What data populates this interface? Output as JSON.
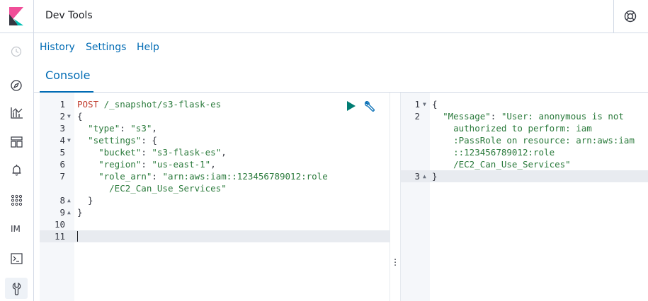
{
  "header": {
    "app_title": "Dev Tools",
    "logo_icon": "kibana-logo-icon",
    "help_icon": "help-lifebuoy-icon"
  },
  "sidenav": {
    "items": [
      {
        "name": "recently-viewed-icon",
        "active": false
      },
      {
        "name": "discover-compass-icon",
        "active": false
      },
      {
        "name": "visualize-chart-icon",
        "active": false
      },
      {
        "name": "dashboard-icon",
        "active": false
      },
      {
        "name": "alerting-bell-icon",
        "active": false
      },
      {
        "name": "apps-grid-icon",
        "active": false
      },
      {
        "name": "index-management-label",
        "label": "IM",
        "active": false
      },
      {
        "name": "console-terminal-icon",
        "active": false
      },
      {
        "name": "management-wrench-icon",
        "active": true
      }
    ]
  },
  "menu": {
    "history": "History",
    "settings": "Settings",
    "help": "Help"
  },
  "tabs": {
    "console": "Console"
  },
  "request_editor": {
    "lines": [
      {
        "num": "1",
        "fold": "",
        "text": [
          [
            "kw",
            "POST "
          ],
          [
            "path",
            "/_snapshot/s3-flask-es"
          ]
        ]
      },
      {
        "num": "2",
        "fold": "down",
        "text": [
          [
            "punc",
            "{"
          ]
        ]
      },
      {
        "num": "3",
        "fold": "",
        "text": [
          [
            "punc",
            "  "
          ],
          [
            "key",
            "\"type\""
          ],
          [
            "punc",
            ": "
          ],
          [
            "str",
            "\"s3\""
          ],
          [
            "punc",
            ","
          ]
        ]
      },
      {
        "num": "4",
        "fold": "down",
        "text": [
          [
            "punc",
            "  "
          ],
          [
            "key",
            "\"settings\""
          ],
          [
            "punc",
            ": {"
          ]
        ]
      },
      {
        "num": "5",
        "fold": "",
        "text": [
          [
            "punc",
            "    "
          ],
          [
            "key",
            "\"bucket\""
          ],
          [
            "punc",
            ": "
          ],
          [
            "str",
            "\"s3-flask-es\""
          ],
          [
            "punc",
            ","
          ]
        ]
      },
      {
        "num": "6",
        "fold": "",
        "text": [
          [
            "punc",
            "    "
          ],
          [
            "key",
            "\"region\""
          ],
          [
            "punc",
            ": "
          ],
          [
            "str",
            "\"us-east-1\""
          ],
          [
            "punc",
            ","
          ]
        ]
      },
      {
        "num": "7",
        "fold": "",
        "text": [
          [
            "punc",
            "    "
          ],
          [
            "key",
            "\"role_arn\""
          ],
          [
            "punc",
            ": "
          ],
          [
            "str",
            "\"arn:aws:iam::123456789012:role"
          ]
        ]
      },
      {
        "num": "",
        "fold": "",
        "text": [
          [
            "punc",
            "      "
          ],
          [
            "str",
            "/EC2_Can_Use_Services\""
          ]
        ]
      },
      {
        "num": "8",
        "fold": "up",
        "text": [
          [
            "punc",
            "  }"
          ]
        ]
      },
      {
        "num": "9",
        "fold": "up",
        "text": [
          [
            "punc",
            "}"
          ]
        ]
      },
      {
        "num": "10",
        "fold": "",
        "text": []
      },
      {
        "num": "11",
        "fold": "",
        "text": [],
        "active": true
      }
    ],
    "play_icon": "play-request-icon",
    "wrench_icon": "request-options-wrench-icon"
  },
  "response_editor": {
    "lines": [
      {
        "num": "1",
        "fold": "down",
        "text": [
          [
            "punc",
            "{"
          ]
        ]
      },
      {
        "num": "2",
        "fold": "",
        "text": [
          [
            "punc",
            "  "
          ],
          [
            "key",
            "\"Message\""
          ],
          [
            "punc",
            ": "
          ],
          [
            "str",
            "\"User: anonymous is not"
          ]
        ]
      },
      {
        "num": "",
        "fold": "",
        "text": [
          [
            "punc",
            "    "
          ],
          [
            "str",
            "authorized to perform: iam"
          ]
        ]
      },
      {
        "num": "",
        "fold": "",
        "text": [
          [
            "punc",
            "    "
          ],
          [
            "str",
            ":PassRole on resource: arn:aws:iam"
          ]
        ]
      },
      {
        "num": "",
        "fold": "",
        "text": [
          [
            "punc",
            "    "
          ],
          [
            "str",
            "::123456789012:role"
          ]
        ]
      },
      {
        "num": "",
        "fold": "",
        "text": [
          [
            "punc",
            "    "
          ],
          [
            "str",
            "/EC2_Can_Use_Services\""
          ]
        ]
      },
      {
        "num": "3",
        "fold": "up",
        "text": [
          [
            "punc",
            "}"
          ]
        ],
        "active": true
      }
    ]
  },
  "colors": {
    "accent": "#006bb4",
    "play_green": "#017d73",
    "keyword_red": "#c0392b",
    "string_green": "#2a7a3b"
  }
}
